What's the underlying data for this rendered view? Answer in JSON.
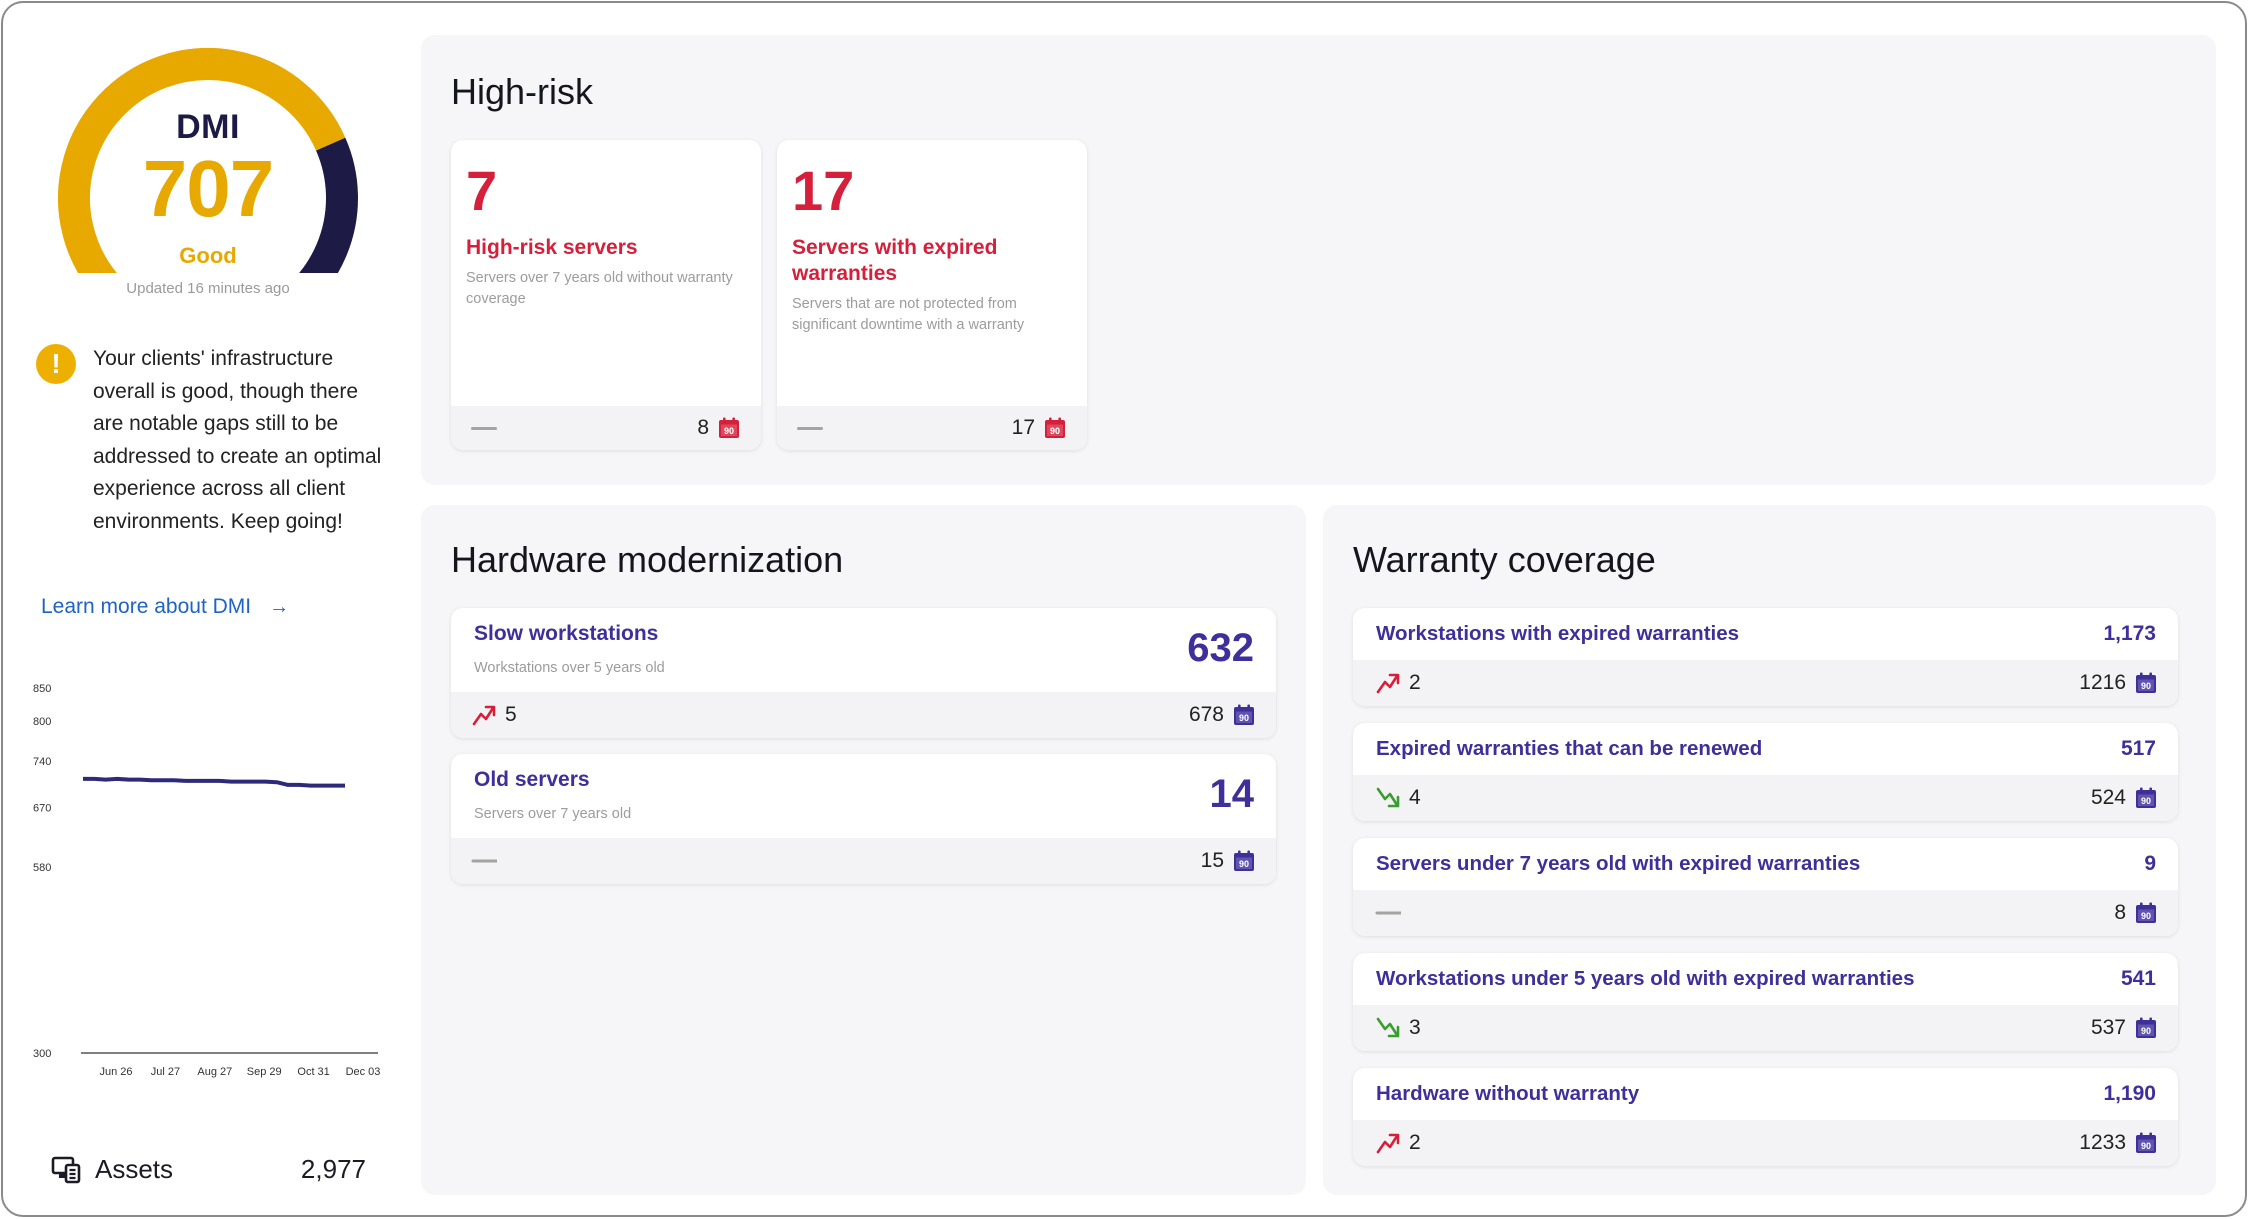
{
  "dmi": {
    "label": "DMI",
    "score": "707",
    "status": "Good",
    "updated": "Updated 16 minutes ago",
    "gauge_fill_fraction": 0.707,
    "gauge_fill_color": "#e7a800",
    "gauge_remain_color": "#1d1b45"
  },
  "alert": {
    "icon": "warning-icon",
    "text": "Your clients' infrastructure overall is good, though there are notable gaps still to be addressed to create an optimal experience across all client environments. Keep going!"
  },
  "learn_more": {
    "label": "Learn more about DMI",
    "arrow": "→"
  },
  "chart_data": {
    "type": "line",
    "title": "",
    "xlabel": "",
    "ylabel": "",
    "y_ticks": [
      850,
      800,
      740,
      670,
      580,
      300
    ],
    "x_ticks": [
      "Jun 26",
      "Jul 27",
      "Aug 27",
      "Sep 29",
      "Oct 31",
      "Dec 03"
    ],
    "series": [
      {
        "values": [
          713,
          713,
          712,
          713,
          712,
          712,
          711,
          711,
          711,
          710,
          710,
          710,
          710,
          709,
          709,
          709,
          709,
          708,
          704,
          704,
          703,
          703,
          703,
          703
        ]
      }
    ],
    "line_color": "#2e2a7a",
    "axis_gradient": [
      "#d6203b",
      "#e7a800",
      "#3bb54a"
    ]
  },
  "assets": {
    "icon": "assets-icon",
    "label": "Assets",
    "value": "2,977"
  },
  "high_risk": {
    "title": "High-risk",
    "cards": [
      {
        "count": "7",
        "title": "High-risk servers",
        "desc": "Servers over 7 years old without warranty coverage",
        "footer_value": "8",
        "trend": "none"
      },
      {
        "count": "17",
        "title": "Servers with expired warranties",
        "desc": "Servers that are not protected from significant downtime with a warranty",
        "footer_value": "17",
        "trend": "none"
      }
    ],
    "calendar_label": "90",
    "accent": "#d6203b"
  },
  "hardware": {
    "title": "Hardware modernization",
    "cards": [
      {
        "title": "Slow workstations",
        "subtitle": "Workstations over 5 years old",
        "value": "632",
        "trend": "up",
        "trend_value": "5",
        "footer_value": "678"
      },
      {
        "title": "Old servers",
        "subtitle": "Servers over 7 years old",
        "value": "14",
        "trend": "none",
        "trend_value": "",
        "footer_value": "15"
      }
    ]
  },
  "warranty": {
    "title": "Warranty coverage",
    "cards": [
      {
        "title": "Workstations with expired warranties",
        "value": "1,173",
        "trend": "up",
        "trend_value": "2",
        "footer_value": "1216"
      },
      {
        "title": "Expired warranties that can be renewed",
        "value": "517",
        "trend": "down",
        "trend_value": "4",
        "footer_value": "524"
      },
      {
        "title": "Servers under 7 years old with expired warranties",
        "value": "9",
        "trend": "none",
        "trend_value": "",
        "footer_value": "8"
      },
      {
        "title": "Workstations under 5 years old with expired warranties",
        "value": "541",
        "trend": "down",
        "trend_value": "3",
        "footer_value": "537"
      },
      {
        "title": "Hardware without warranty",
        "value": "1,190",
        "trend": "up",
        "trend_value": "2",
        "footer_value": "1233"
      }
    ]
  },
  "colors": {
    "primary": "#3e2f9a",
    "danger": "#d6203b",
    "trend_up": "#d6203b",
    "trend_down": "#3a9e2e",
    "link": "#1f63c4"
  }
}
